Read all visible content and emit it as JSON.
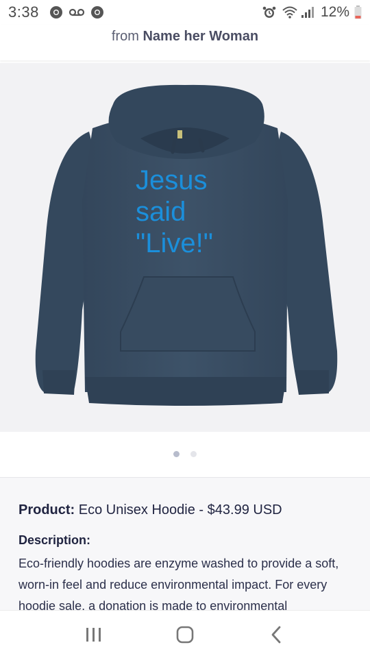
{
  "status_bar": {
    "time": "3:38",
    "battery_percent": "12%",
    "icons": [
      "chrome-icon",
      "voicemail-icon",
      "chrome-icon",
      "alarm-icon",
      "wifi-icon",
      "signal-icon",
      "battery-icon"
    ]
  },
  "header": {
    "prefix": "from",
    "shop_name": "Name her Woman"
  },
  "product_image": {
    "print_lines": [
      "Jesus",
      "said",
      "\"Live!\""
    ],
    "hoodie_color": "#3b4f65",
    "print_color": "#1b8fdb"
  },
  "carousel": {
    "count": 2,
    "active_index": 0
  },
  "details": {
    "product_label": "Product:",
    "product_value": "Eco Unisex Hoodie - $43.99 USD",
    "description_label": "Description:",
    "description_text": "Eco-friendly hoodies are enzyme washed to provide a soft, worn-in feel and reduce environmental impact. For every hoodie sale, a donation is made to environmental"
  },
  "nav": {
    "buttons": [
      "recent-apps",
      "home",
      "back"
    ]
  }
}
